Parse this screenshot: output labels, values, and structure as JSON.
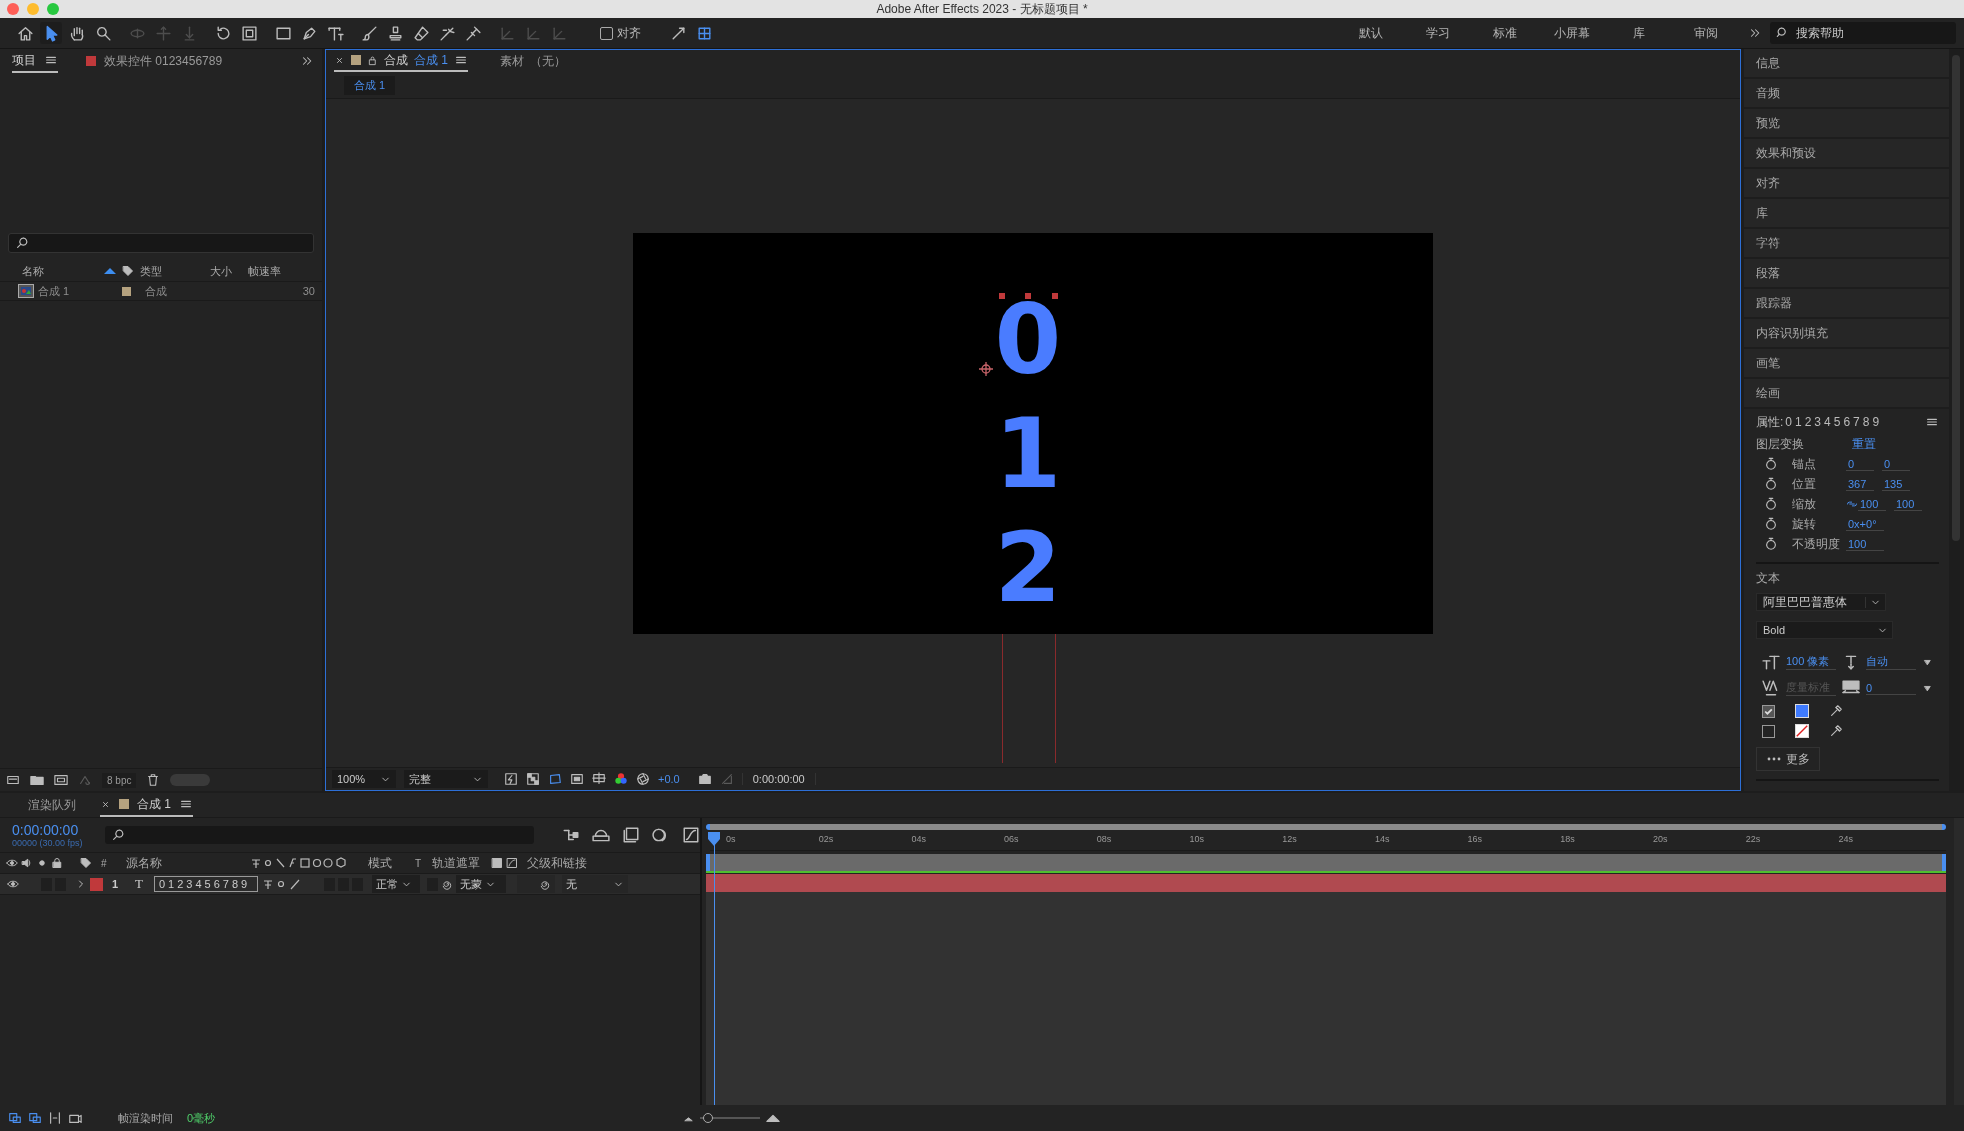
{
  "window": {
    "title": "Adobe After Effects 2023 - 无标题项目 *"
  },
  "toolbar": {
    "tools": [
      {
        "kind": "home",
        "selected": false,
        "disabled": false
      },
      {
        "kind": "selection",
        "selected": true,
        "disabled": false
      },
      {
        "kind": "hand",
        "selected": false,
        "disabled": false
      },
      {
        "kind": "zoom",
        "selected": false,
        "disabled": false
      },
      {
        "kind": "orbit",
        "selected": false,
        "disabled": true
      },
      {
        "kind": "pan",
        "selected": false,
        "disabled": true
      },
      {
        "kind": "dolly",
        "selected": false,
        "disabled": true
      },
      {
        "kind": "rotate",
        "selected": false,
        "disabled": false
      },
      {
        "kind": "region",
        "selected": false,
        "disabled": false
      },
      {
        "kind": "rectangle",
        "selected": false,
        "disabled": false
      },
      {
        "kind": "pen",
        "selected": false,
        "disabled": false
      },
      {
        "kind": "type",
        "selected": false,
        "disabled": false
      },
      {
        "kind": "brush",
        "selected": false,
        "disabled": false
      },
      {
        "kind": "stamp",
        "selected": false,
        "disabled": false
      },
      {
        "kind": "eraser",
        "selected": false,
        "disabled": false
      },
      {
        "kind": "roto",
        "selected": false,
        "disabled": false
      },
      {
        "kind": "pin",
        "selected": false,
        "disabled": false
      },
      {
        "kind": "axis",
        "selected": false,
        "disabled": true
      },
      {
        "kind": "axis",
        "selected": false,
        "disabled": true
      },
      {
        "kind": "axis",
        "selected": false,
        "disabled": true
      }
    ],
    "snap": {
      "label": "对齐",
      "checked": false
    },
    "snap_tools": [
      {
        "kind": "snap_line",
        "selected": false
      },
      {
        "kind": "snap_grid",
        "selected": true
      }
    ],
    "workspaces": [
      {
        "label": "默认",
        "selected": false
      },
      {
        "label": "学习",
        "selected": false
      },
      {
        "label": "标准",
        "selected": false
      },
      {
        "label": "小屏幕",
        "selected": false
      },
      {
        "label": "库",
        "selected": false
      },
      {
        "label": "审阅",
        "selected": false
      }
    ],
    "search": {
      "placeholder": "搜索帮助"
    }
  },
  "project": {
    "tabs": [
      {
        "label": "项目",
        "selected": true
      },
      {
        "label": "效果控件 0123456789",
        "selected": false,
        "color": "#c0393b"
      }
    ],
    "columns": [
      "名称",
      "类型",
      "大小",
      "帧速率"
    ],
    "items": [
      {
        "name": "合成 1",
        "type": "合成",
        "frame_rate": "30",
        "color": "#b5a27f"
      }
    ],
    "bit_depth": "8 bpc"
  },
  "viewer": {
    "tabs": [
      {
        "kind": "composition",
        "prefix": "合成",
        "label": "合成 1",
        "selected": true
      },
      {
        "kind": "footage",
        "prefix": "素材",
        "label": "（无）",
        "selected": false
      }
    ],
    "breadcrumb": "合成 1",
    "canvas": {
      "lines": [
        "0",
        "1",
        "2"
      ]
    },
    "footer": {
      "zoom": "100%",
      "resolution": "完整",
      "exposure": "+0.0",
      "timecode": "0:00:00:00"
    }
  },
  "panels": [
    "信息",
    "音频",
    "预览",
    "效果和预设",
    "对齐",
    "库",
    "字符",
    "段落",
    "跟踪器",
    "内容识别填充",
    "画笔",
    "绘画"
  ],
  "properties": {
    "label": "属性:",
    "layer": "0123456789",
    "transform": {
      "title": "图层变换",
      "reset": "重置",
      "rows": [
        {
          "label": "锚点",
          "values": [
            "0",
            "0"
          ],
          "linked": false
        },
        {
          "label": "位置",
          "values": [
            "367",
            "135"
          ],
          "linked": false
        },
        {
          "label": "缩放",
          "values": [
            "100",
            "100"
          ],
          "linked": true
        },
        {
          "label": "旋转",
          "values": [
            "0x+0°"
          ],
          "linked": false
        },
        {
          "label": "不透明度",
          "values": [
            "100"
          ],
          "linked": false
        }
      ]
    },
    "text": {
      "title": "文本",
      "font": "阿里巴巴普惠体",
      "style": "Bold",
      "size": "100 像素",
      "leading": "自动",
      "kerning": "度量标准",
      "tracking": "0",
      "fill": {
        "checked": true,
        "color": "#3f7bff"
      },
      "stroke": {
        "checked": false
      },
      "more": "更多"
    }
  },
  "timeline": {
    "tabs": [
      {
        "label": "渲染队列",
        "selected": false
      },
      {
        "label": "合成 1",
        "selected": true,
        "color": "#b5a27f"
      }
    ],
    "timecode": "0:00:00:00",
    "frame_info": "00000 (30.00 fps)",
    "columns": {
      "index": "#",
      "name": "源名称",
      "mode": "模式",
      "t": "T",
      "matte": "轨道遮罩",
      "parent": "父级和链接"
    },
    "layers": [
      {
        "index": "1",
        "type_glyph": "T",
        "name": "0123456789",
        "mode": "正常",
        "matte": "无蒙",
        "parent": "无",
        "color": "#c0393b",
        "visible": true
      }
    ],
    "ruler": [
      "0s",
      "02s",
      "04s",
      "06s",
      "08s",
      "10s",
      "12s",
      "14s",
      "16s",
      "18s",
      "20s",
      "22s",
      "24s"
    ]
  },
  "status_bar": {
    "label": "帧渲染时间",
    "value": "0毫秒",
    "time_zoom": {
      "level": 0.05
    }
  }
}
